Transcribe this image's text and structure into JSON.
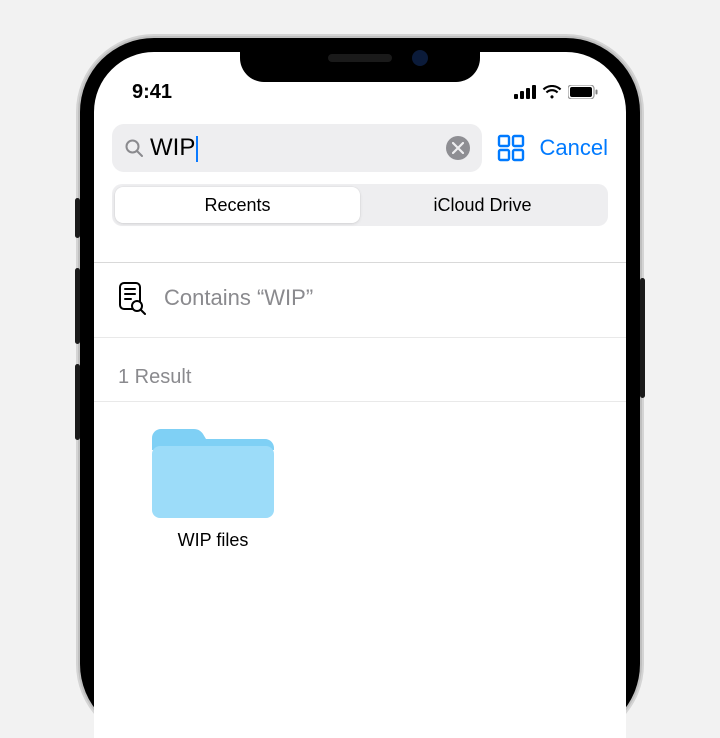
{
  "status": {
    "time": "9:41"
  },
  "search": {
    "value": "WIP",
    "cancel_label": "Cancel"
  },
  "segmented": {
    "items": [
      "Recents",
      "iCloud Drive"
    ],
    "active": 0
  },
  "suggestion": {
    "text": "Contains “WIP”"
  },
  "results": {
    "header": "1 Result",
    "items": [
      {
        "name": "WIP files",
        "type": "folder"
      }
    ]
  },
  "colors": {
    "accent": "#007aff",
    "folder": "#7fd0f5"
  }
}
